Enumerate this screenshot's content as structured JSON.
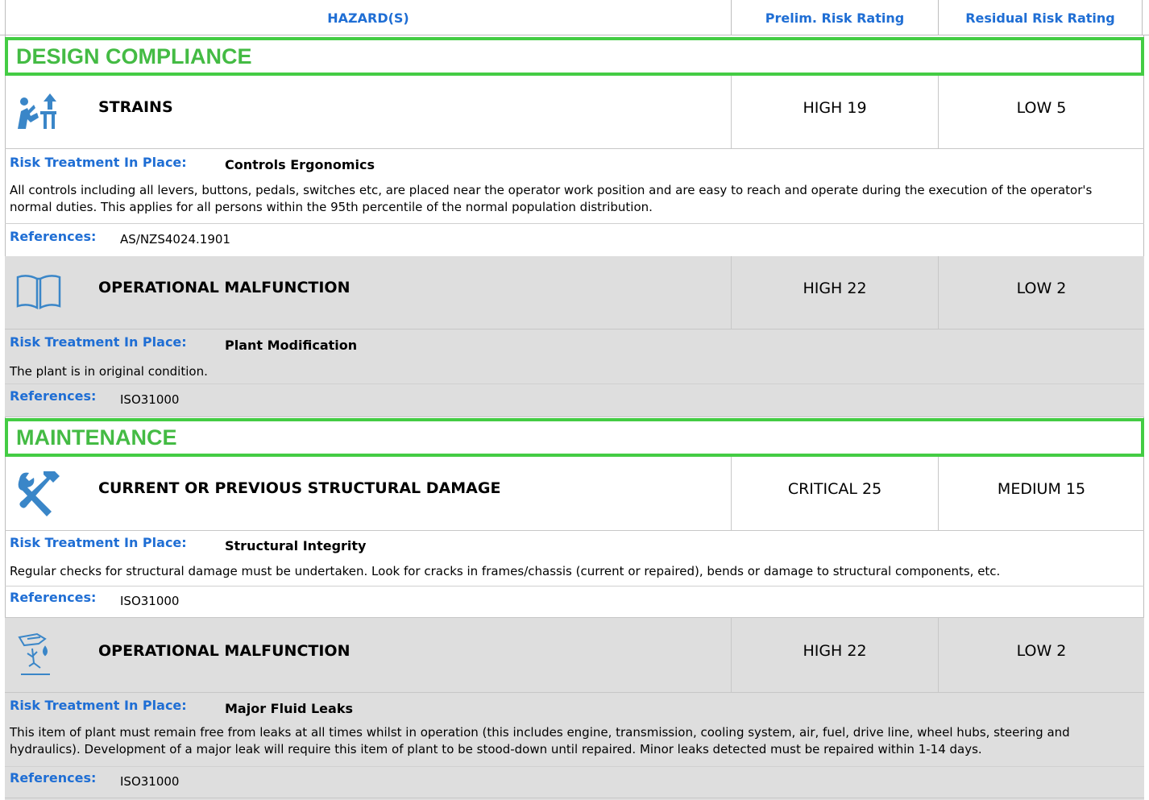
{
  "header": {
    "hazards": "HAZARD(S)",
    "prelim": "Prelim. Risk Rating",
    "residual": "Residual Risk Rating"
  },
  "sections": [
    {
      "title": "DESIGN COMPLIANCE"
    },
    {
      "title": "MAINTENANCE"
    }
  ],
  "hazards": [
    {
      "icon": "ergonomics-icon",
      "name": "STRAINS",
      "prelim": "HIGH 19",
      "residual": "LOW 5",
      "treatment_label": "Risk Treatment In Place:",
      "treatment": "Controls Ergonomics",
      "description": "All controls including all levers, buttons, pedals, switches etc, are placed near the operator work position and are easy to reach and operate during the execution of the operator's normal duties. This applies for all persons within the 95th percentile of the normal population distribution.",
      "references_label": "References:",
      "references": "AS/NZS4024.1901"
    },
    {
      "icon": "manual-book-icon",
      "name": "OPERATIONAL MALFUNCTION",
      "prelim": "HIGH 22",
      "residual": "LOW 2",
      "treatment_label": "Risk Treatment In Place:",
      "treatment": "Plant Modification",
      "description": "The plant is in original condition.",
      "references_label": "References:",
      "references": "ISO31000"
    },
    {
      "icon": "tools-icon",
      "name": "CURRENT OR PREVIOUS STRUCTURAL DAMAGE",
      "prelim": "CRITICAL 25",
      "residual": "MEDIUM 15",
      "treatment_label": "Risk Treatment In Place:",
      "treatment": "Structural Integrity",
      "description": "Regular checks for structural damage must be undertaken. Look for cracks in frames/chassis (current or repaired), bends or damage to structural components, etc.",
      "references_label": "References:",
      "references": "ISO31000"
    },
    {
      "icon": "fluid-leak-icon",
      "name": "OPERATIONAL MALFUNCTION",
      "prelim": "HIGH 22",
      "residual": "LOW 2",
      "treatment_label": "Risk Treatment In Place:",
      "treatment": "Major Fluid Leaks",
      "description": "This item of plant must remain free from leaks at all times whilst in operation (this includes engine, transmission, cooling system, air, fuel, drive line, wheel hubs, steering and hydraulics). Development of a major leak will require this item of plant to be stood-down until repaired. Minor leaks detected must be repaired within 1-14 days.",
      "references_label": "References:",
      "references": "ISO31000"
    }
  ]
}
